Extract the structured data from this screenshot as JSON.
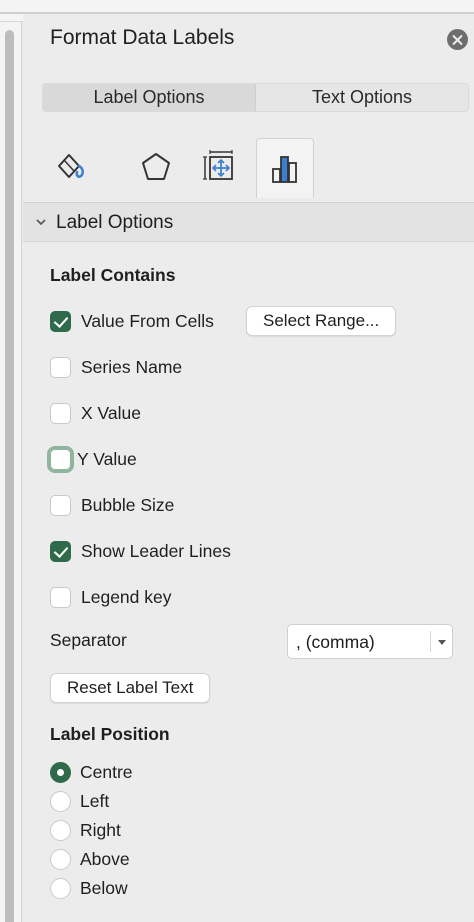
{
  "panel": {
    "title": "Format Data Labels"
  },
  "segments": [
    {
      "label": "Label Options",
      "active": true
    },
    {
      "label": "Text Options",
      "active": false
    }
  ],
  "icon_tabs": [
    {
      "icon": "fill-line-icon",
      "active": false
    },
    {
      "icon": "effects-pentagon-icon",
      "active": false
    },
    {
      "icon": "size-properties-icon",
      "active": false
    },
    {
      "icon": "bar-chart-icon",
      "active": true
    }
  ],
  "section": {
    "title": "Label Options",
    "expanded": true
  },
  "label_contains": {
    "title": "Label Contains",
    "items": [
      {
        "label": "Value From Cells",
        "checked": true
      },
      {
        "label": "Series Name",
        "checked": false
      },
      {
        "label": "X Value",
        "checked": false
      },
      {
        "label": "Y Value",
        "checked": false,
        "focused": true
      },
      {
        "label": "Bubble Size",
        "checked": false
      },
      {
        "label": "Show Leader Lines",
        "checked": true
      },
      {
        "label": "Legend key",
        "checked": false
      }
    ],
    "select_range_label": "Select Range..."
  },
  "separator": {
    "label": "Separator",
    "value": ", (comma)"
  },
  "reset_button_label": "Reset Label Text",
  "label_position": {
    "title": "Label Position",
    "options": [
      {
        "label": "Centre",
        "selected": true
      },
      {
        "label": "Left",
        "selected": false
      },
      {
        "label": "Right",
        "selected": false
      },
      {
        "label": "Above",
        "selected": false
      },
      {
        "label": "Below",
        "selected": false
      }
    ]
  },
  "colors": {
    "accent": "#2f6b4a",
    "focus_ring": "#8fb59d",
    "icon_blue": "#3b7fd1"
  }
}
